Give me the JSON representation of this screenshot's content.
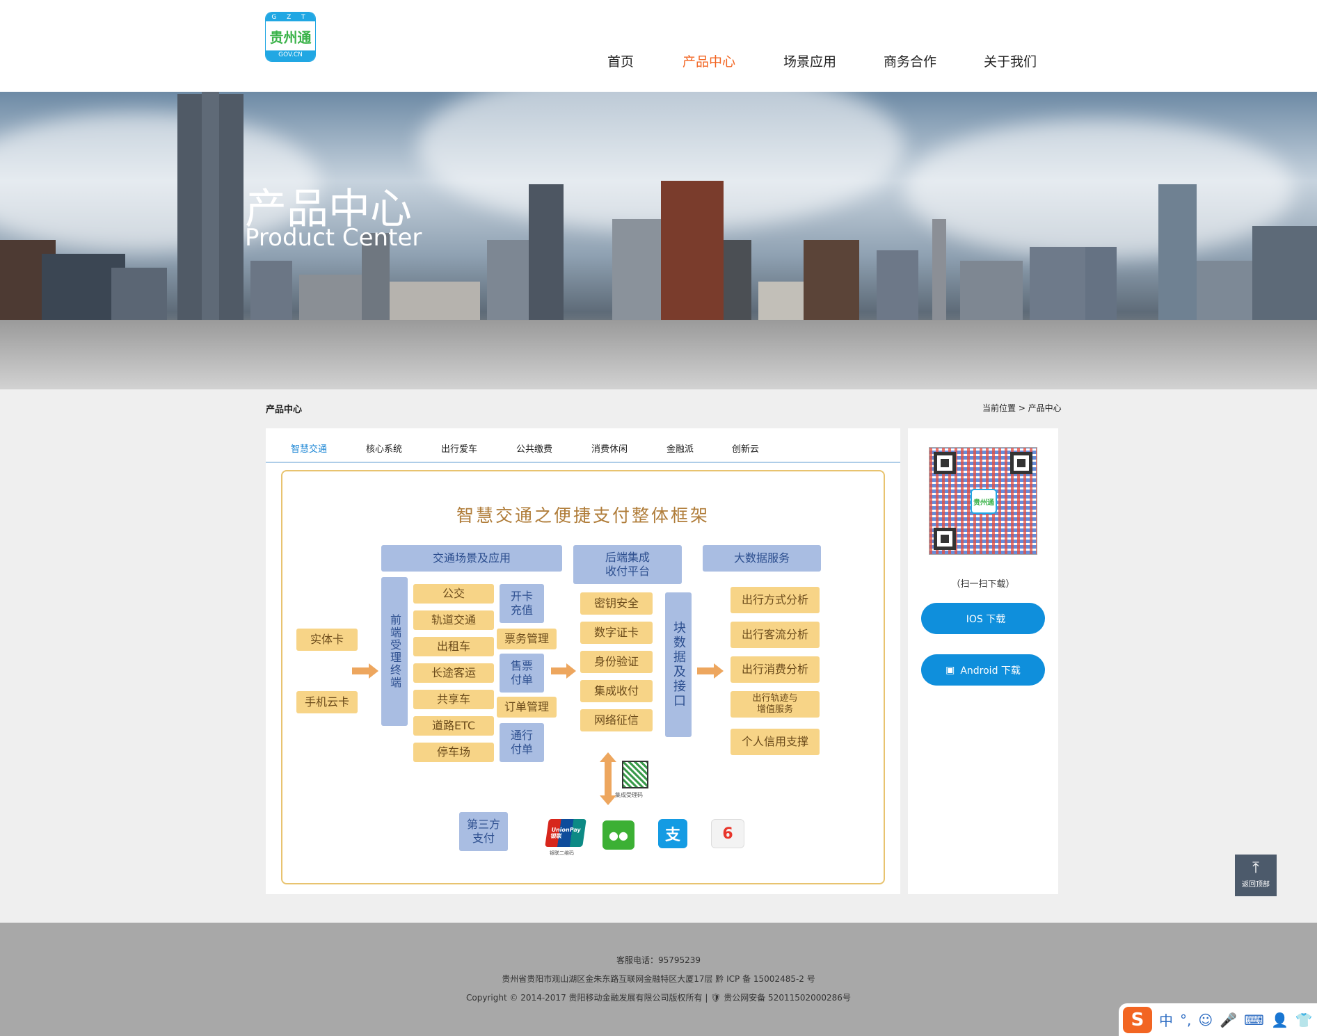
{
  "logo": {
    "top": "G Z T",
    "name": "贵州通",
    "domain": "GOV.CN"
  },
  "nav": [
    "首页",
    "产品中心",
    "场景应用",
    "商务合作",
    "关于我们"
  ],
  "banner": {
    "title": "产品中心",
    "subtitle": "Product Center"
  },
  "breadcrumb": {
    "section": "产品中心",
    "location": "当前位置 > 产品中心"
  },
  "tabs": [
    "智慧交通",
    "核心系统",
    "出行爱车",
    "公共缴费",
    "消费休闲",
    "金融派",
    "创新云"
  ],
  "diagram": {
    "title": "智慧交通之便捷支付整体框架",
    "cards": [
      "实体卡",
      "手机云卡"
    ],
    "scene_header": "交通场景及应用",
    "terminal": "前端受理终端",
    "scenes": [
      "公交",
      "轨道交通",
      "出租车",
      "长途客运",
      "共享车",
      "道路ETC",
      "停车场"
    ],
    "services": [
      "开卡\n充值",
      "票务管理",
      "售票\n付单",
      "订单管理",
      "通行\n付单"
    ],
    "backend_header": "后端集成\n收付平台",
    "backend": [
      "密钥安全",
      "数字证卡",
      "身份验证",
      "集成收付",
      "网络征信"
    ],
    "data_interface": "块数据及接口",
    "bigdata_header": "大数据服务",
    "bigdata": [
      "出行方式分析",
      "出行客流分析",
      "出行消费分析",
      "出行轨迹与\n增值服务",
      "个人信用支撑"
    ],
    "qr_label": "集成受理码",
    "third_party": "第三方\n支付",
    "unionpay": "UnionPay\n银联",
    "unionpay_caption": "银联二维码",
    "wechat": "●●",
    "alipay": "支",
    "yi": "6"
  },
  "side": {
    "qr_text": "贵州通",
    "scan": "（扫一扫下载）",
    "ios": "IOS 下载",
    "android": "Android 下载",
    "ios_icon": "",
    "android_icon": "▣"
  },
  "totop": {
    "icon": "⤒",
    "label": "返回顶部"
  },
  "footer": {
    "phone": "客服电话：95795239",
    "address": "贵州省贵阳市观山湖区金朱东路互联网金融特区大厦17层 黔 ICP 备 15002485-2 号",
    "copyright": "Copyright © 2014-2017 贵阳移动金融发展有限公司版权所有 | 🛡 贵公网安备 52011502000286号"
  },
  "ime": {
    "logo": "S",
    "lang": "中",
    "punct": "°,",
    "emoji": "☺",
    "mic": "🎤",
    "keyboard": "⌨",
    "user": "👤",
    "skin": "👕"
  }
}
